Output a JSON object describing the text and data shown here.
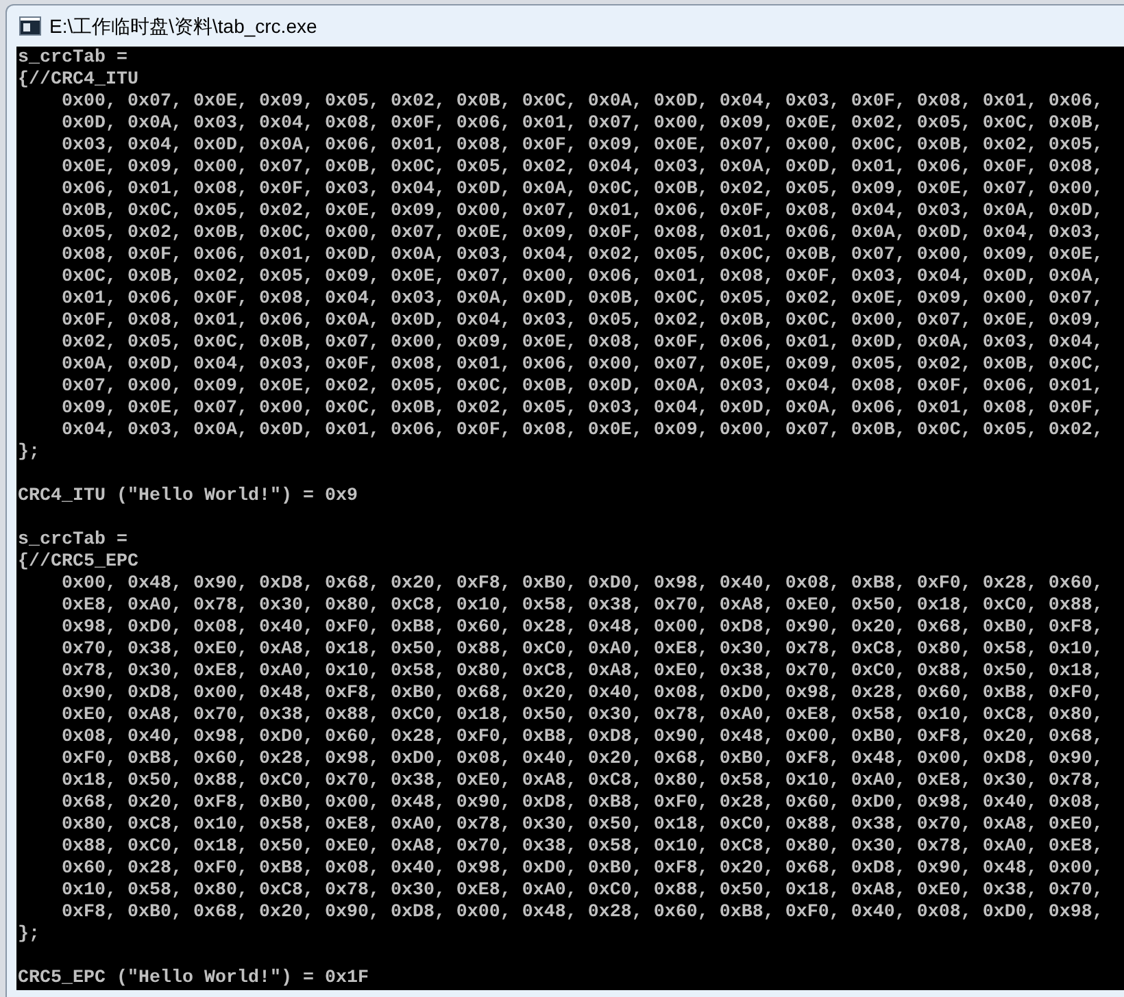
{
  "window": {
    "title": "E:\\工作临时盘\\资料\\tab_crc.exe"
  },
  "console": {
    "sections": [
      {
        "header": "s_crcTab =",
        "open": "{//CRC4_ITU",
        "close": "};",
        "result": "CRC4_ITU (\"Hello World!\") = 0x9",
        "rows": [
          "0x00, 0x07, 0x0E, 0x09, 0x05, 0x02, 0x0B, 0x0C, 0x0A, 0x0D, 0x04, 0x03, 0x0F, 0x08, 0x01, 0x06,",
          "0x0D, 0x0A, 0x03, 0x04, 0x08, 0x0F, 0x06, 0x01, 0x07, 0x00, 0x09, 0x0E, 0x02, 0x05, 0x0C, 0x0B,",
          "0x03, 0x04, 0x0D, 0x0A, 0x06, 0x01, 0x08, 0x0F, 0x09, 0x0E, 0x07, 0x00, 0x0C, 0x0B, 0x02, 0x05,",
          "0x0E, 0x09, 0x00, 0x07, 0x0B, 0x0C, 0x05, 0x02, 0x04, 0x03, 0x0A, 0x0D, 0x01, 0x06, 0x0F, 0x08,",
          "0x06, 0x01, 0x08, 0x0F, 0x03, 0x04, 0x0D, 0x0A, 0x0C, 0x0B, 0x02, 0x05, 0x09, 0x0E, 0x07, 0x00,",
          "0x0B, 0x0C, 0x05, 0x02, 0x0E, 0x09, 0x00, 0x07, 0x01, 0x06, 0x0F, 0x08, 0x04, 0x03, 0x0A, 0x0D,",
          "0x05, 0x02, 0x0B, 0x0C, 0x00, 0x07, 0x0E, 0x09, 0x0F, 0x08, 0x01, 0x06, 0x0A, 0x0D, 0x04, 0x03,",
          "0x08, 0x0F, 0x06, 0x01, 0x0D, 0x0A, 0x03, 0x04, 0x02, 0x05, 0x0C, 0x0B, 0x07, 0x00, 0x09, 0x0E,",
          "0x0C, 0x0B, 0x02, 0x05, 0x09, 0x0E, 0x07, 0x00, 0x06, 0x01, 0x08, 0x0F, 0x03, 0x04, 0x0D, 0x0A,",
          "0x01, 0x06, 0x0F, 0x08, 0x04, 0x03, 0x0A, 0x0D, 0x0B, 0x0C, 0x05, 0x02, 0x0E, 0x09, 0x00, 0x07,",
          "0x0F, 0x08, 0x01, 0x06, 0x0A, 0x0D, 0x04, 0x03, 0x05, 0x02, 0x0B, 0x0C, 0x00, 0x07, 0x0E, 0x09,",
          "0x02, 0x05, 0x0C, 0x0B, 0x07, 0x00, 0x09, 0x0E, 0x08, 0x0F, 0x06, 0x01, 0x0D, 0x0A, 0x03, 0x04,",
          "0x0A, 0x0D, 0x04, 0x03, 0x0F, 0x08, 0x01, 0x06, 0x00, 0x07, 0x0E, 0x09, 0x05, 0x02, 0x0B, 0x0C,",
          "0x07, 0x00, 0x09, 0x0E, 0x02, 0x05, 0x0C, 0x0B, 0x0D, 0x0A, 0x03, 0x04, 0x08, 0x0F, 0x06, 0x01,",
          "0x09, 0x0E, 0x07, 0x00, 0x0C, 0x0B, 0x02, 0x05, 0x03, 0x04, 0x0D, 0x0A, 0x06, 0x01, 0x08, 0x0F,",
          "0x04, 0x03, 0x0A, 0x0D, 0x01, 0x06, 0x0F, 0x08, 0x0E, 0x09, 0x00, 0x07, 0x0B, 0x0C, 0x05, 0x02,"
        ]
      },
      {
        "header": "s_crcTab =",
        "open": "{//CRC5_EPC",
        "close": "};",
        "result": "CRC5_EPC (\"Hello World!\") = 0x1F",
        "rows": [
          "0x00, 0x48, 0x90, 0xD8, 0x68, 0x20, 0xF8, 0xB0, 0xD0, 0x98, 0x40, 0x08, 0xB8, 0xF0, 0x28, 0x60,",
          "0xE8, 0xA0, 0x78, 0x30, 0x80, 0xC8, 0x10, 0x58, 0x38, 0x70, 0xA8, 0xE0, 0x50, 0x18, 0xC0, 0x88,",
          "0x98, 0xD0, 0x08, 0x40, 0xF0, 0xB8, 0x60, 0x28, 0x48, 0x00, 0xD8, 0x90, 0x20, 0x68, 0xB0, 0xF8,",
          "0x70, 0x38, 0xE0, 0xA8, 0x18, 0x50, 0x88, 0xC0, 0xA0, 0xE8, 0x30, 0x78, 0xC8, 0x80, 0x58, 0x10,",
          "0x78, 0x30, 0xE8, 0xA0, 0x10, 0x58, 0x80, 0xC8, 0xA8, 0xE0, 0x38, 0x70, 0xC0, 0x88, 0x50, 0x18,",
          "0x90, 0xD8, 0x00, 0x48, 0xF8, 0xB0, 0x68, 0x20, 0x40, 0x08, 0xD0, 0x98, 0x28, 0x60, 0xB8, 0xF0,",
          "0xE0, 0xA8, 0x70, 0x38, 0x88, 0xC0, 0x18, 0x50, 0x30, 0x78, 0xA0, 0xE8, 0x58, 0x10, 0xC8, 0x80,",
          "0x08, 0x40, 0x98, 0xD0, 0x60, 0x28, 0xF0, 0xB8, 0xD8, 0x90, 0x48, 0x00, 0xB0, 0xF8, 0x20, 0x68,",
          "0xF0, 0xB8, 0x60, 0x28, 0x98, 0xD0, 0x08, 0x40, 0x20, 0x68, 0xB0, 0xF8, 0x48, 0x00, 0xD8, 0x90,",
          "0x18, 0x50, 0x88, 0xC0, 0x70, 0x38, 0xE0, 0xA8, 0xC8, 0x80, 0x58, 0x10, 0xA0, 0xE8, 0x30, 0x78,",
          "0x68, 0x20, 0xF8, 0xB0, 0x00, 0x48, 0x90, 0xD8, 0xB8, 0xF0, 0x28, 0x60, 0xD0, 0x98, 0x40, 0x08,",
          "0x80, 0xC8, 0x10, 0x58, 0xE8, 0xA0, 0x78, 0x30, 0x50, 0x18, 0xC0, 0x88, 0x38, 0x70, 0xA8, 0xE0,",
          "0x88, 0xC0, 0x18, 0x50, 0xE0, 0xA8, 0x70, 0x38, 0x58, 0x10, 0xC8, 0x80, 0x30, 0x78, 0xA0, 0xE8,",
          "0x60, 0x28, 0xF0, 0xB8, 0x08, 0x40, 0x98, 0xD0, 0xB0, 0xF8, 0x20, 0x68, 0xD8, 0x90, 0x48, 0x00,",
          "0x10, 0x58, 0x80, 0xC8, 0x78, 0x30, 0xE8, 0xA0, 0xC0, 0x88, 0x50, 0x18, 0xA8, 0xE0, 0x38, 0x70,",
          "0xF8, 0xB0, 0x68, 0x20, 0x90, 0xD8, 0x00, 0x48, 0x28, 0x60, 0xB8, 0xF0, 0x40, 0x08, 0xD0, 0x98,"
        ]
      }
    ]
  }
}
